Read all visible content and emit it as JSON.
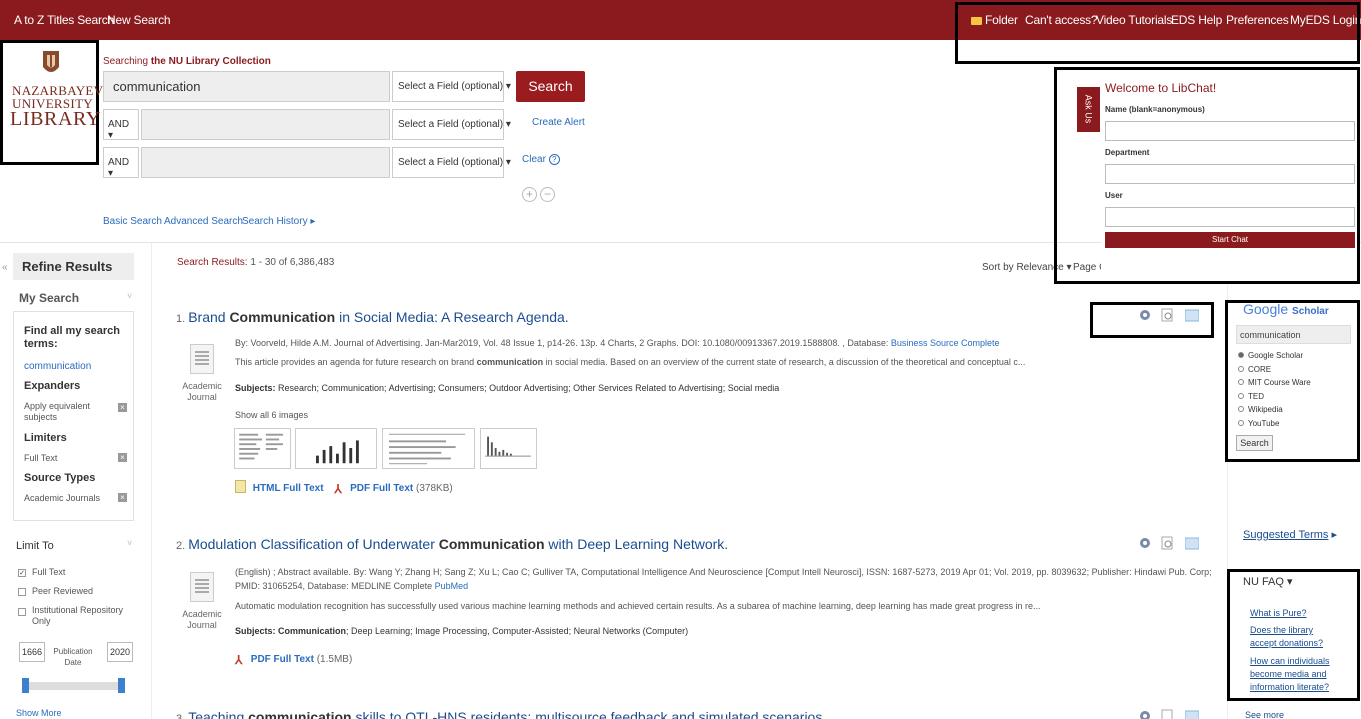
{
  "topbar": {
    "left_links": [
      "A to Z Titles Search",
      "New Search"
    ],
    "right_links": [
      "Folder",
      "Can't access?",
      "Video Tutorials",
      "EDS Help",
      "Preferences",
      "MyEDS Login"
    ]
  },
  "logo": {
    "line1": "NAZARBAYEV",
    "line2": "UNIVERSITY",
    "line3": "LIBRARY"
  },
  "search": {
    "searching_prefix": "Searching",
    "collection": "the NU Library Collection",
    "query": "communication",
    "field_placeholder": "Select a Field (optional)",
    "bool_op": "AND",
    "search_label": "Search",
    "create_alert": "Create Alert",
    "clear": "Clear",
    "plus": "+",
    "minus": "−",
    "links": [
      "Basic Search",
      "Advanced Search",
      "Search History"
    ]
  },
  "sidebar": {
    "collapse": "«",
    "title": "Refine Results",
    "my_search": "My Search",
    "find_all": "Find all my search terms:",
    "term": "communication",
    "expanders": "Expanders",
    "expander_item": "Apply equivalent subjects",
    "limiters": "Limiters",
    "limiter_item": "Full Text",
    "source_types": "Source Types",
    "source_item": "Academic Journals",
    "limit_to": "Limit To",
    "checkboxes": [
      {
        "label": "Full Text",
        "checked": true
      },
      {
        "label": "Peer Reviewed",
        "checked": false
      },
      {
        "label": "Institutional Repository Only",
        "checked": false
      }
    ],
    "pub_date_label": "Publication Date",
    "date_from": "1666",
    "date_to": "2020",
    "show_more": "Show More"
  },
  "results": {
    "summary_label": "Search Results:",
    "summary_range": "1 - 30 of 6,386,483",
    "sort": "Sort by Relevance",
    "page_options": "Page O",
    "items": [
      {
        "num": "1.",
        "title_pre": "Brand ",
        "title_bold": "Communication",
        "title_post": " in Social Media: A Research Agenda.",
        "byline": "By: Voorveld, Hilde A.M. Journal of Advertising. Jan-Mar2019, Vol. 48 Issue 1, p14-26. 13p. 4 Charts, 2 Graphs. DOI: 10.1080/00913367.2019.1588808. , Database: ",
        "database": "Business Source Complete",
        "abstract_pre": "This article provides an agenda for future research on brand ",
        "abstract_bold": "communication",
        "abstract_post": " in social media. Based on an overview of the current state of research, a discussion of the theoretical and conceptual c...",
        "subjects_label": "Subjects:",
        "subjects_text": " Research; Communication; Advertising; Consumers; Outdoor Advertising; Other Services Related to Advertising; Social media",
        "type": "Academic Journal",
        "show_images": "Show all 6 images",
        "html_full": "HTML Full Text",
        "pdf_full": "PDF Full Text",
        "pdf_size": "(378KB)"
      },
      {
        "num": "2.",
        "title_pre": "Modulation Classification of Underwater ",
        "title_bold": "Communication",
        "title_post": " with Deep Learning Network.",
        "byline1": "(English) ; Abstract available. By: Wang Y; Zhang H; Sang Z; Xu L; Cao C; Gulliver TA, Computational Intelligence And Neuroscience [Comput Intell Neurosci], ISSN: 1687-5273, 2019 Apr 01; Vol. 2019, pp. 8039632; Publisher: Hindawi Pub. Corp;",
        "byline2": "PMID: 31065254, Database: MEDLINE Complete ",
        "database": "PubMed",
        "abstract": "Automatic modulation recognition has successfully used various machine learning methods and achieved certain results. As a subarea of machine learning, deep learning has made great progress in re...",
        "subjects_label": "Subjects:",
        "subjects_bold": " Communication",
        "subjects_text": "; Deep Learning; Image Processing, Computer-Assisted; Neural Networks (Computer)",
        "type": "Academic Journal",
        "pdf_full": "PDF Full Text",
        "pdf_size": "(1.5MB)"
      },
      {
        "num": "3.",
        "title_pre": "Teaching ",
        "title_bold": "communication",
        "title_post": " skills to OTL-HNS residents: multisource feedback and simulated scenarios"
      }
    ]
  },
  "libchat": {
    "tab": "Ask Us",
    "welcome": "Welcome to LibChat!",
    "name_label": "Name (blank=anonymous)",
    "department_label": "Department",
    "user_label": "User",
    "start": "Start Chat"
  },
  "scholar": {
    "logo_google": "Google",
    "logo_scholar": "Scholar",
    "query": "communication",
    "options": [
      "Google Scholar",
      "CORE",
      "MIT Course Ware",
      "TED",
      "Wikipedia",
      "YouTube"
    ],
    "button": "Search"
  },
  "suggested": "Suggested Terms",
  "faq": {
    "title": "NU FAQ",
    "links": [
      "What is Pure?",
      "Does the library accept donations?",
      "How can individuals become media and information literate?"
    ],
    "see_more": "See more"
  },
  "colors": {
    "brand": "#8a1a1d",
    "link": "#1a4d8f",
    "highlight_box": "#000000"
  }
}
